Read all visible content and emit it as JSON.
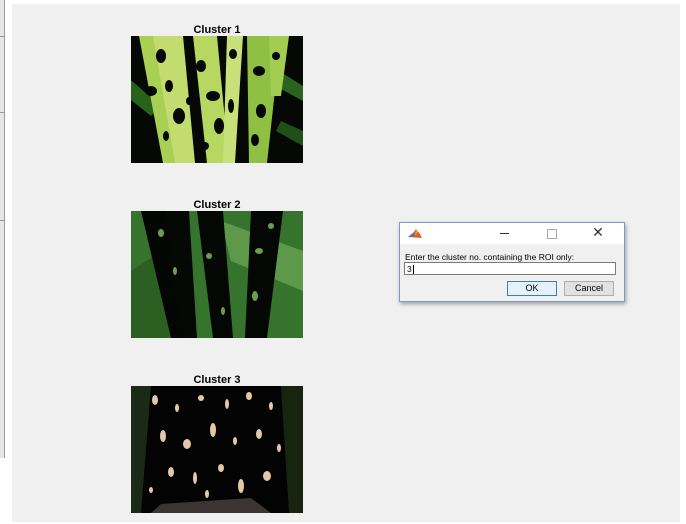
{
  "figure": {
    "clusters": [
      {
        "title": "Cluster 1"
      },
      {
        "title": "Cluster 2"
      },
      {
        "title": "Cluster 3"
      }
    ]
  },
  "dialog": {
    "icon": "matlab-icon",
    "window_controls": [
      "minimize-icon",
      "maximize-icon",
      "close-icon"
    ],
    "prompt": "Enter the cluster no. containing the ROI only:",
    "input_value": "3",
    "ok_label": "OK",
    "cancel_label": "Cancel"
  }
}
